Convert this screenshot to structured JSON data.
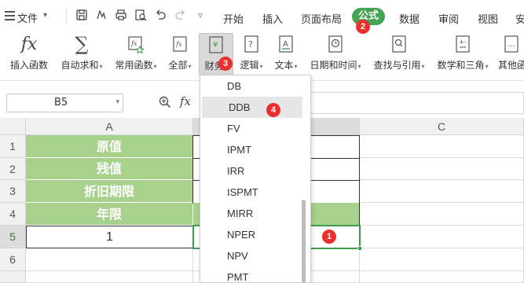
{
  "menubar": {
    "file_label": "文件",
    "tabs": [
      "开始",
      "插入",
      "页面布局",
      "公式",
      "数据",
      "审阅",
      "视图",
      "安"
    ],
    "active_tab": "公式",
    "accent_color": "#44a454"
  },
  "ribbon": {
    "buttons": [
      {
        "label": "插入函数",
        "icon": "fx-icon",
        "has_caret": false
      },
      {
        "label": "自动求和",
        "icon": "sigma-icon",
        "has_caret": true
      },
      {
        "label": "常用函数",
        "icon": "star-fx-icon",
        "has_caret": true
      },
      {
        "label": "全部",
        "icon": "all-fx-icon",
        "has_caret": true
      },
      {
        "label": "财务",
        "icon": "finance-icon",
        "has_caret": true
      },
      {
        "label": "逻辑",
        "icon": "logic-icon",
        "has_caret": true
      },
      {
        "label": "文本",
        "icon": "text-icon",
        "has_caret": true
      },
      {
        "label": "日期和时间",
        "icon": "clock-icon",
        "has_caret": true
      },
      {
        "label": "查找与引用",
        "icon": "lookup-icon",
        "has_caret": true
      },
      {
        "label": "数学和三角",
        "icon": "math-icon",
        "has_caret": true
      },
      {
        "label": "其他函",
        "icon": "other-icon",
        "has_caret": false
      }
    ],
    "caret": "▾"
  },
  "formula_bar": {
    "name_box": "B5",
    "fx": "fx",
    "formula": ""
  },
  "sheet": {
    "columns": [
      "A",
      "B",
      "C"
    ],
    "rows": [
      "1",
      "2",
      "3",
      "4",
      "5",
      "6"
    ],
    "selected_row": "5",
    "cells": {
      "A1": "原值",
      "A2": "残值",
      "A3": "折旧期限",
      "A4": "年限",
      "A5": "1"
    },
    "fill_color": "#a9d18e"
  },
  "dropdown": {
    "items": [
      "DB",
      "DDB",
      "FV",
      "IPMT",
      "IRR",
      "ISPMT",
      "MIRR",
      "NPER",
      "NPV",
      "PMT"
    ],
    "hovered": "DDB"
  },
  "badges": {
    "b1": "1",
    "b2": "2",
    "b3": "3",
    "b4": "4"
  }
}
